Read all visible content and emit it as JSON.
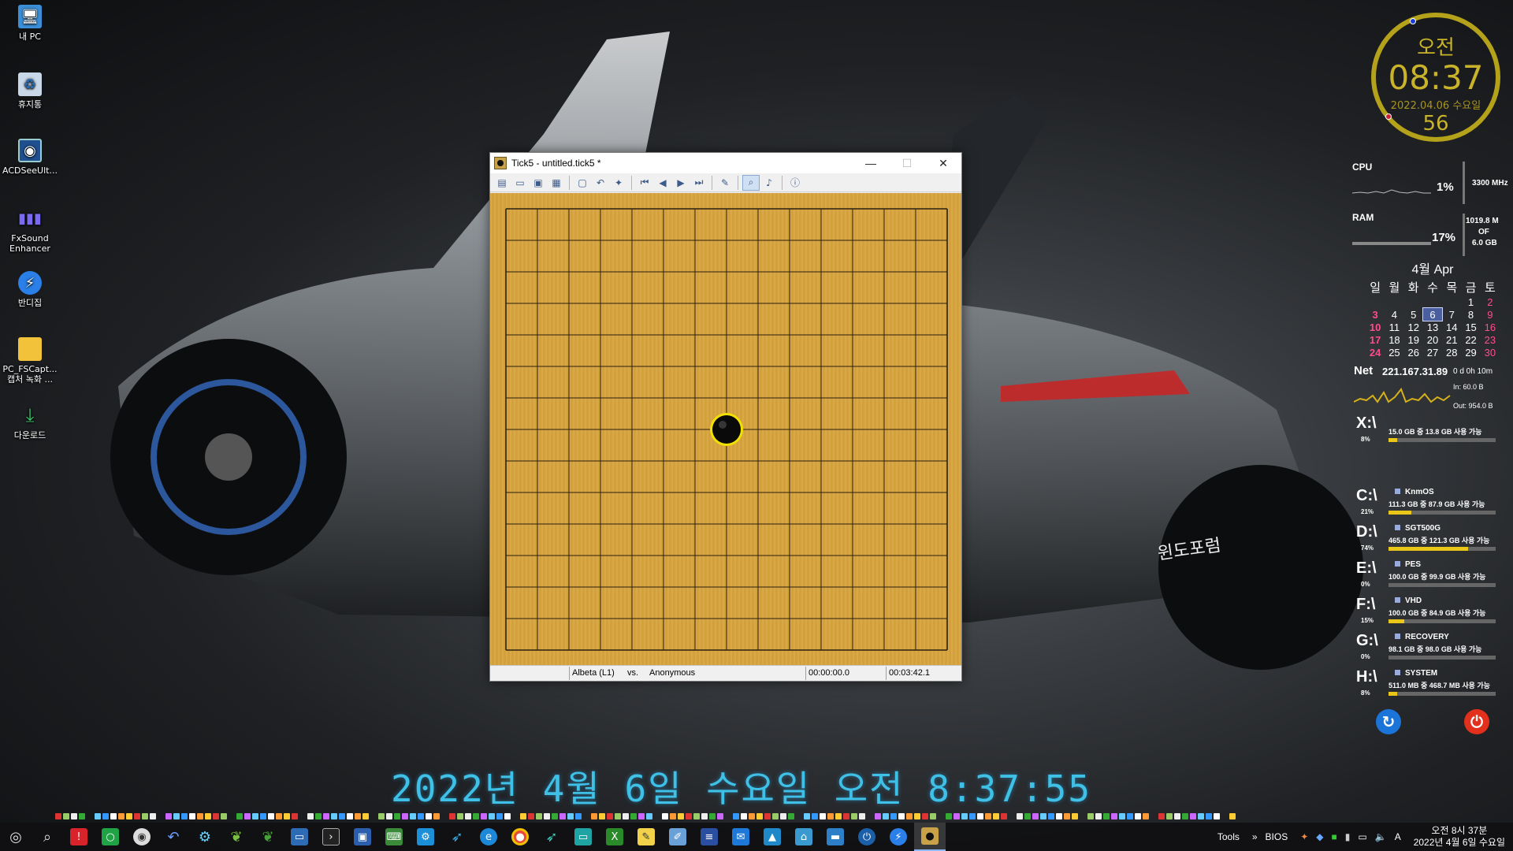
{
  "desktop_icons": [
    {
      "label": "내 PC",
      "icon": "computer-icon"
    },
    {
      "label": "휴지통",
      "icon": "recycle-bin-icon"
    },
    {
      "label": "ACDSeeUlt...",
      "icon": "acdsee-icon"
    },
    {
      "label": "FxSound Enhancer",
      "icon": "fxsound-icon"
    },
    {
      "label": "반디집",
      "icon": "bandizip-icon"
    },
    {
      "label": "PC_FSCapt... 캡처 녹화 ...",
      "icon": "folder-icon"
    },
    {
      "label": "다운로드",
      "icon": "download-icon"
    }
  ],
  "window": {
    "title": "Tick5 - untitled.tick5 *",
    "controls": {
      "minimize": "—",
      "maximize": "☐",
      "close": "✕"
    },
    "toolbar_icons": [
      "new-icon",
      "open-icon",
      "save-icon",
      "save-as-icon",
      "board-icon",
      "undo-icon",
      "hint-icon",
      "first-move-icon",
      "prev-move-icon",
      "next-move-icon",
      "last-move-icon",
      "settings-icon",
      "zoom-icon",
      "sound-icon",
      "info-icon"
    ],
    "status": {
      "player_black": "Albeta (L1)",
      "vs": "vs.",
      "player_white": "Anonymous",
      "time_black": "00:00:00.0",
      "time_white": "00:03:42.1"
    },
    "board": {
      "lines": 15,
      "stones": [
        {
          "col": 7,
          "row": 7,
          "color": "black",
          "last": true
        }
      ]
    }
  },
  "big_date": "2022년  4월  6일  수요일 오전 8:37:55",
  "clock_widget": {
    "ampm": "오전",
    "time": "08:37",
    "date": "2022.04.06 수요일",
    "seconds": "56"
  },
  "system": {
    "cpu_label": "CPU",
    "cpu_pct": "1%",
    "cpu_freq": "3300 MHz",
    "ram_label": "RAM",
    "ram_pct": "17%",
    "ram_used": "1019.8 M",
    "ram_of": "OF",
    "ram_total": "6.0 GB"
  },
  "calendar": {
    "title": "4월 Apr",
    "weekdays": [
      "일",
      "월",
      "화",
      "수",
      "목",
      "금",
      "토"
    ],
    "weeks": [
      [
        "",
        "",
        "",
        "",
        "",
        "1",
        "2"
      ],
      [
        "3",
        "4",
        "5",
        "6",
        "7",
        "8",
        "9"
      ],
      [
        "10",
        "11",
        "12",
        "13",
        "14",
        "15",
        "16"
      ],
      [
        "17",
        "18",
        "19",
        "20",
        "21",
        "22",
        "23"
      ],
      [
        "24",
        "25",
        "26",
        "27",
        "28",
        "29",
        "30"
      ]
    ],
    "today": "6"
  },
  "net": {
    "label": "Net",
    "ip": "221.167.31.89",
    "uptime": "0 d 0h 10m",
    "in": "In: 60.0 B",
    "out": "Out: 954.0 B"
  },
  "drives": [
    {
      "letter": "X:\\",
      "pct": "8%",
      "name": "",
      "info": "15.0 GB 중  13.8 GB 사용 가능",
      "fill": 0.08
    },
    {
      "letter": "C:\\",
      "pct": "21%",
      "name": "KnmOS",
      "info": "111.3 GB 중  87.9 GB 사용 가능",
      "fill": 0.21
    },
    {
      "letter": "D:\\",
      "pct": "74%",
      "name": "SGT500G",
      "info": "465.8 GB 중  121.3 GB 사용 가능",
      "fill": 0.74
    },
    {
      "letter": "E:\\",
      "pct": "0%",
      "name": "PES",
      "info": "100.0 GB 중  99.9 GB 사용 가능",
      "fill": 0.0
    },
    {
      "letter": "F:\\",
      "pct": "15%",
      "name": "VHD",
      "info": "100.0 GB 중  84.9 GB 사용 가능",
      "fill": 0.15
    },
    {
      "letter": "G:\\",
      "pct": "0%",
      "name": "RECOVERY",
      "info": "98.1 GB 중   98.0 GB 사용 가능",
      "fill": 0.0
    },
    {
      "letter": "H:\\",
      "pct": "8%",
      "name": "SYSTEM",
      "info": "511.0 MB 중 468.7 MB 사용 가능",
      "fill": 0.08
    }
  ],
  "taskbar": {
    "tray_labels": [
      "Tools",
      "BIOS"
    ],
    "clock_line1": "오전 8시 37분",
    "clock_line2": "2022년  4월  6일  수요일"
  },
  "colors": {
    "board": "#d9a63f",
    "accent_cyan": "#3fc0e6",
    "clock_gold": "#c8b32a",
    "drive_bar": "#e9c617"
  }
}
